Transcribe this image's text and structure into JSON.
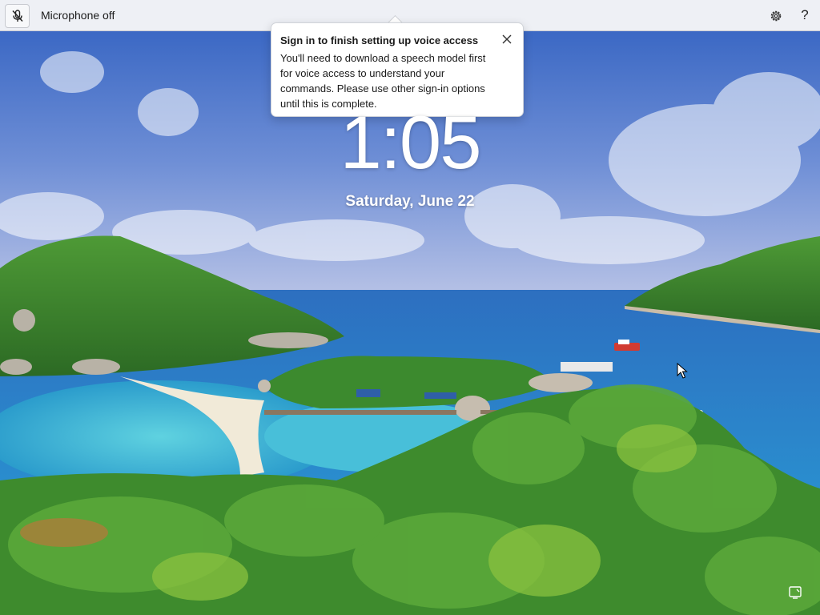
{
  "topbar": {
    "mic_status": "Microphone off",
    "icons": [
      "mic-off-icon",
      "gear-icon",
      "help-icon"
    ],
    "help_glyph": "?"
  },
  "tooltip": {
    "title": "Sign in to finish setting up voice access",
    "body": "You'll need to download a speech model first for voice access to understand your commands. Please use other sign-in options until this is complete.",
    "icons": [
      "close-icon"
    ]
  },
  "lockscreen": {
    "time": "1:05",
    "date": "Saturday, June 22",
    "icons": [
      "accessibility-icon",
      "mouse-pointer-icon"
    ]
  },
  "colors": {
    "topbar_bg": "#eef0f5",
    "sky": "#3f6fc8",
    "sea": "#2a86c6",
    "lagoon": "#3fb7d6",
    "foliage": "#3d8a2c"
  }
}
